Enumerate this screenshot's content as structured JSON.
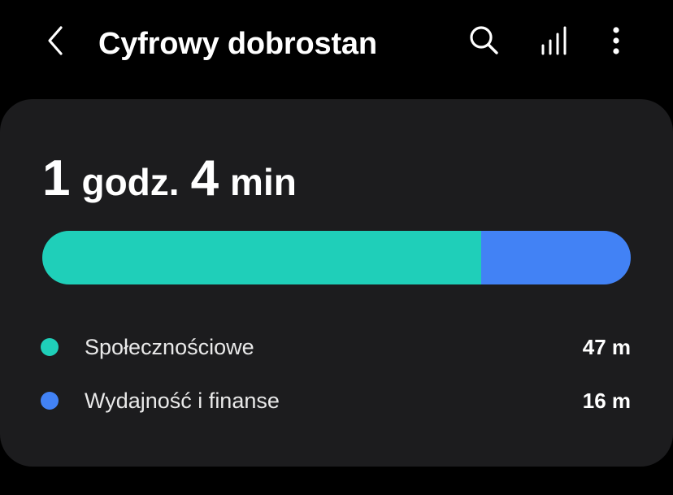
{
  "header": {
    "title": "Cyfrowy dobrostan",
    "back_icon": "chevron-left-icon",
    "search_icon": "search-icon",
    "stats_icon": "bar-chart-icon",
    "more_icon": "more-vertical-icon"
  },
  "summary": {
    "hours_value": "1",
    "hours_unit": "godz.",
    "minutes_value": "4",
    "minutes_unit": "min"
  },
  "usage_bar": {
    "segments": [
      {
        "category": "Społecznościowe",
        "minutes": 47,
        "color": "#1fcfb9"
      },
      {
        "category": "Wydajność i finanse",
        "minutes": 16,
        "color": "#4282f5"
      }
    ]
  },
  "legend": {
    "items": [
      {
        "label": "Społecznościowe",
        "value": "47 m",
        "color": "#1fcfb9"
      },
      {
        "label": "Wydajność i finanse",
        "value": "16 m",
        "color": "#4282f5"
      }
    ]
  }
}
